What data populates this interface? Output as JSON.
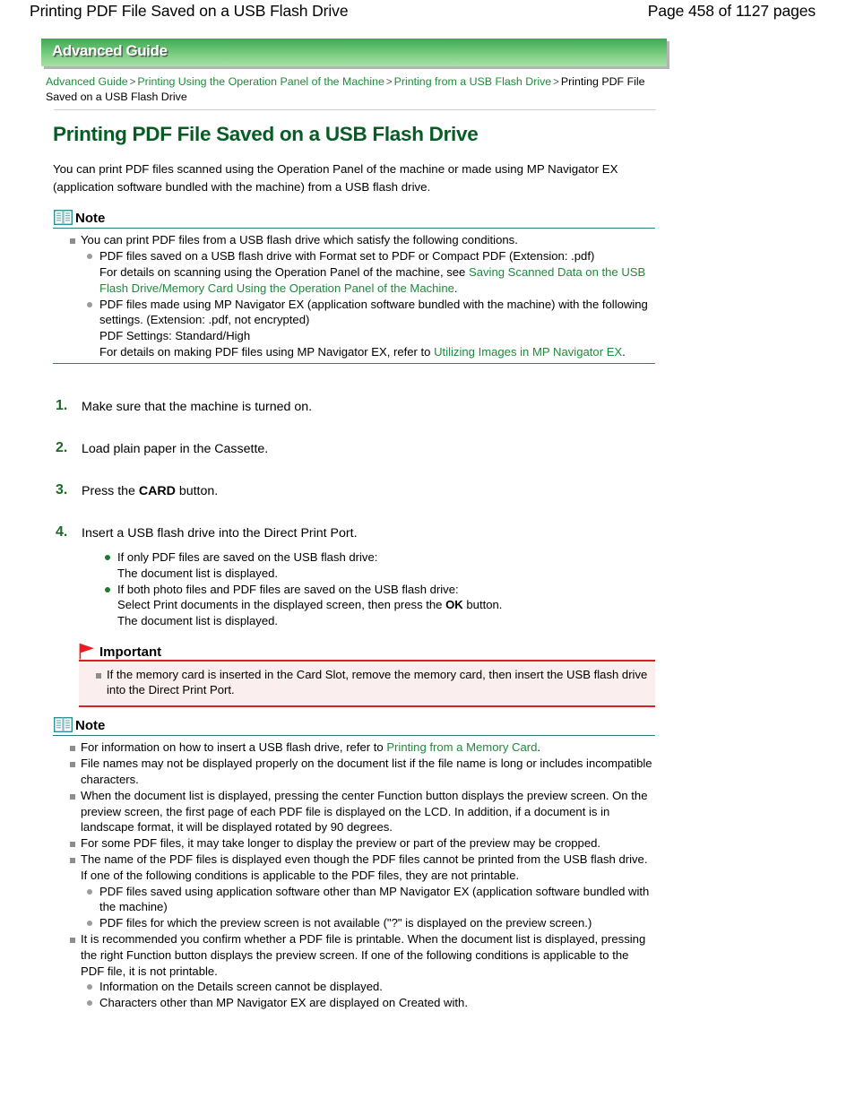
{
  "runhead": {
    "title": "Printing PDF File Saved on a USB Flash Drive",
    "page_indicator": "Page 458 of 1127 pages"
  },
  "guide_banner": {
    "label": "Advanced Guide",
    "gradient_top": "#3faa52",
    "gradient_bottom": "#a9e0a6"
  },
  "breadcrumb": {
    "items": [
      "Advanced Guide",
      "Printing Using the Operation Panel of the Machine",
      "Printing from a USB Flash Drive",
      "Printing PDF File Saved on a USB Flash Drive"
    ],
    "separator": ">",
    "link_color": "#1f8a3b"
  },
  "page_title": "Printing PDF File Saved on a USB Flash Drive",
  "intro": "You can print PDF files scanned using the Operation Panel of the machine or made using MP Navigator EX (application software bundled with the machine) from a USB flash drive.",
  "note1": {
    "icon": "book-icon",
    "label": "Note",
    "rule_color": "#2e7d80",
    "item1": "You can print PDF files from a USB flash drive which satisfy the following conditions.",
    "sub1_line1": "PDF files saved on a USB flash drive with Format set to PDF or Compact PDF (Extension: .pdf)",
    "sub1_line2_pre": "For details on scanning using the Operation Panel of the machine, see",
    "sub1_link": "Saving Scanned Data on the USB Flash Drive/Memory Card Using the Operation Panel of the Machine",
    "sub1_line2_post": ".",
    "sub2_line1": "PDF files made using MP Navigator EX (application software bundled with the machine) with the following settings. (Extension: .pdf, not encrypted)",
    "sub2_line2": "PDF Settings: Standard/High",
    "sub2_line3_pre": "For details on making PDF files using MP Navigator EX, refer to",
    "sub2_link": "Utilizing Images in MP Navigator EX",
    "sub2_line3_post": "."
  },
  "steps": [
    {
      "number": "1.",
      "text": "Make sure that the machine is turned on."
    },
    {
      "number": "2.",
      "text": "Load plain paper in the Cassette."
    },
    {
      "number": "3.",
      "text_pre": "Press the",
      "text_bold": "CARD",
      "text_post": "button."
    },
    {
      "number": "4.",
      "text": "Insert a USB flash drive into the Direct Print Port.",
      "sub": [
        {
          "line1": "If only PDF files are saved on the USB flash drive:",
          "line2": "The document list is displayed."
        },
        {
          "line1": "If both photo files and PDF files are saved on the USB flash drive:",
          "line2_pre": "Select Print documents in the displayed screen, then press the",
          "line2_bold": "OK",
          "line2_post": "button.",
          "line3": "The document list is displayed."
        }
      ]
    }
  ],
  "important": {
    "icon": "flag-icon",
    "label": "Important",
    "rule_color": "#d61f26",
    "background": "#fbeeee",
    "item1": "If the memory card is inserted in the Card Slot, remove the memory card, then insert the USB flash drive into the Direct Print Port."
  },
  "note2": {
    "icon": "book-icon",
    "label": "Note",
    "rule_color": "#2e7d80",
    "item1_pre": "For information on how to insert a USB flash drive, refer to",
    "item1_link": "Printing from a Memory Card",
    "item1_post": ".",
    "item2": "File names may not be displayed properly on the document list if the file name is long or includes incompatible characters.",
    "item3": "When the document list is displayed, pressing the center Function button displays the preview screen. On the preview screen, the first page of each PDF file is displayed on the LCD. In addition, if a document is in landscape format, it will be displayed rotated by 90 degrees.",
    "item4": "For some PDF files, it may take longer to display the preview or part of the preview may be cropped.",
    "item5": "The name of the PDF files is displayed even though the PDF files cannot be printed from the USB flash drive. If one of the following conditions is applicable to the PDF files, they are not printable.",
    "item5_sub1": "PDF files saved using application software other than MP Navigator EX (application software bundled with the machine)",
    "item5_sub2": "PDF files for which the preview screen is not available (\"?\" is displayed on the preview screen.)",
    "item6": "It is recommended you confirm whether a PDF file is printable. When the document list is displayed, pressing the right Function button displays the preview screen. If one of the following conditions is applicable to the PDF file, it is not printable.",
    "item6_sub1": "Information on the Details screen cannot be displayed.",
    "item6_sub2": "Characters other than MP Navigator EX are displayed on Created with."
  }
}
